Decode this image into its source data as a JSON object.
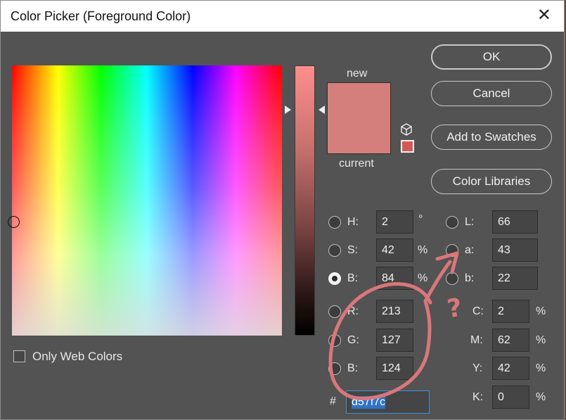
{
  "window": {
    "title": "Color Picker (Foreground Color)"
  },
  "swatch": {
    "new_label": "new",
    "current_label": "current",
    "color": "#d57f7c"
  },
  "buttons": {
    "ok": "OK",
    "cancel": "Cancel",
    "add_to_swatches": "Add to Swatches",
    "color_libraries": "Color Libraries"
  },
  "hsb": {
    "h": {
      "label": "H:",
      "value": "2",
      "unit": "°"
    },
    "s": {
      "label": "S:",
      "value": "42",
      "unit": "%"
    },
    "b": {
      "label": "B:",
      "value": "84",
      "unit": "%"
    }
  },
  "rgb": {
    "r": {
      "label": "R:",
      "value": "213"
    },
    "g": {
      "label": "G:",
      "value": "127"
    },
    "b": {
      "label": "B:",
      "value": "124"
    }
  },
  "lab": {
    "l": {
      "label": "L:",
      "value": "66"
    },
    "a": {
      "label": "a:",
      "value": "43"
    },
    "b": {
      "label": "b:",
      "value": "22"
    }
  },
  "cmyk": {
    "c": {
      "label": "C:",
      "value": "2",
      "unit": "%"
    },
    "m": {
      "label": "M:",
      "value": "62",
      "unit": "%"
    },
    "y": {
      "label": "Y:",
      "value": "42",
      "unit": "%"
    },
    "k": {
      "label": "K:",
      "value": "0",
      "unit": "%"
    }
  },
  "hex": {
    "label": "#",
    "value": "d57f7c"
  },
  "web_colors": {
    "label": "Only Web Colors",
    "checked": false
  },
  "selected_mode": "B",
  "annotation": {
    "color": "#d9777a",
    "text": "?"
  }
}
